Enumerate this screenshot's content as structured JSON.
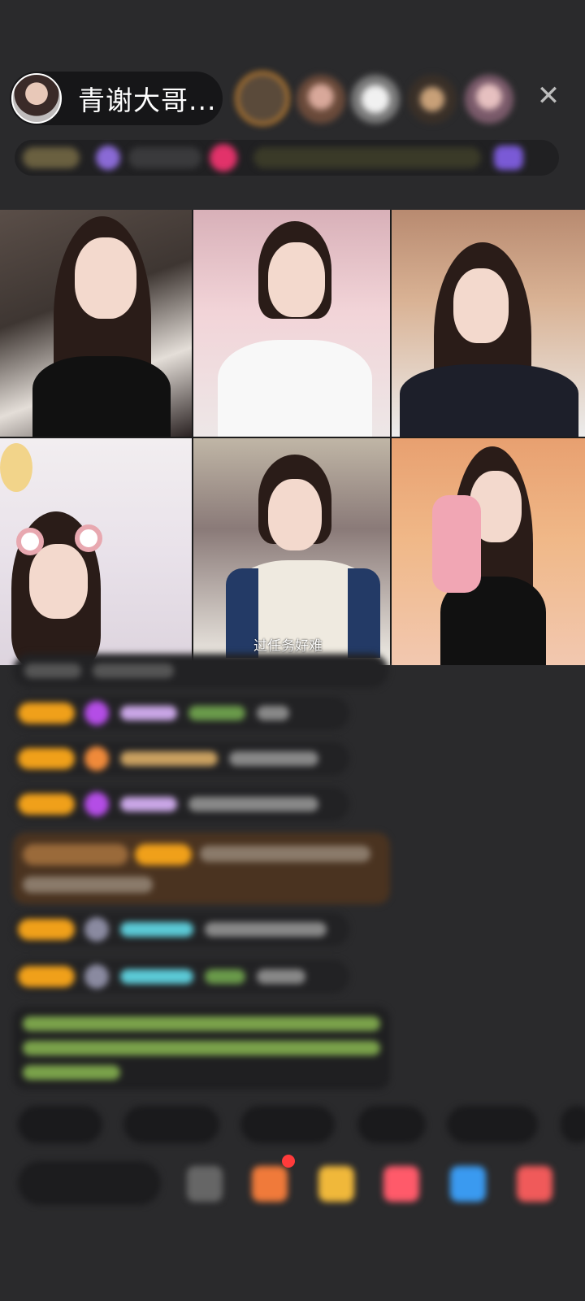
{
  "header": {
    "host_name": "青谢大哥...",
    "close_icon": "close-icon"
  },
  "video_grid": {
    "subtitle": "过任务好难"
  },
  "colors": {
    "background": "#2a2a2c",
    "badge_orange": "#f0a01a",
    "gem_purple": "#b44de6",
    "name_purple": "#c9a6e6",
    "name_teal": "#5bc9d6",
    "text_green": "#9ad45e",
    "panel_brown": "#4a3320"
  }
}
